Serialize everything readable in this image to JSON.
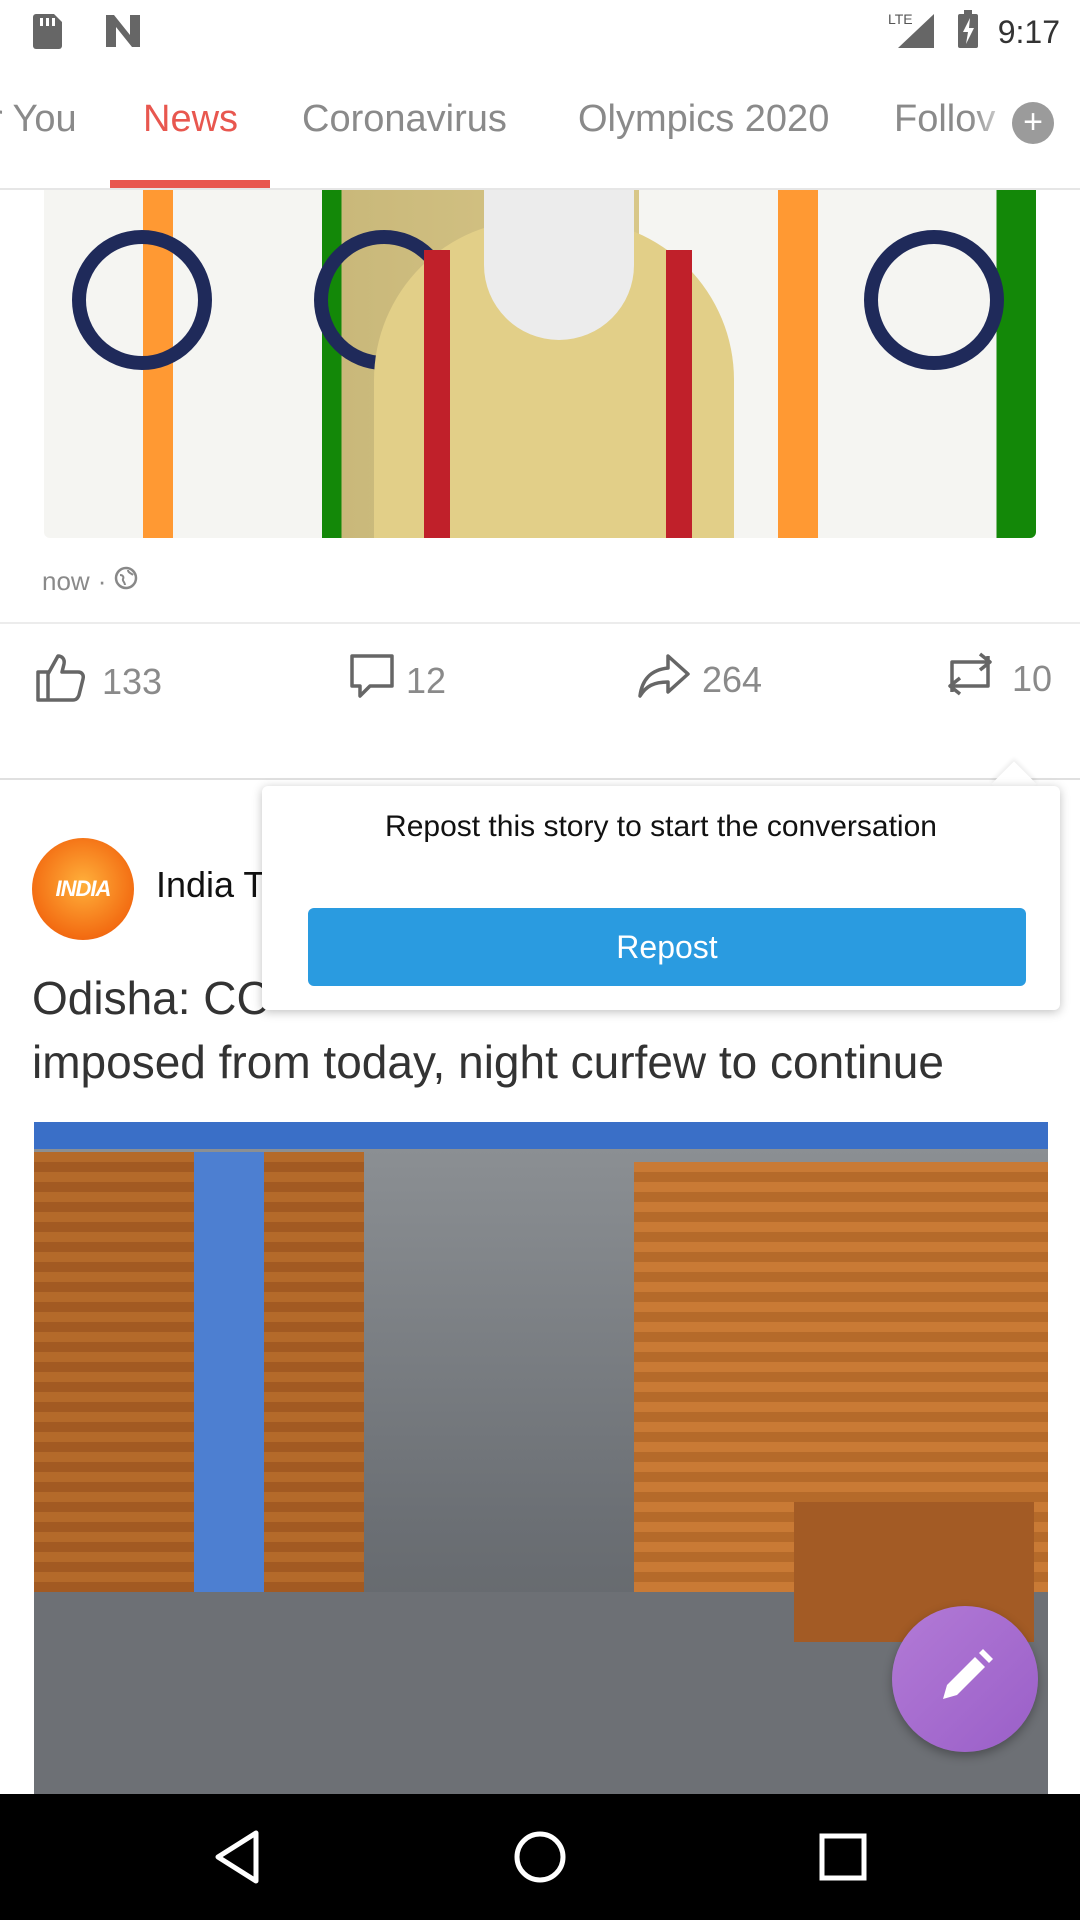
{
  "status_bar": {
    "time": "9:17",
    "network": "LTE",
    "icons": [
      "sd-card-icon",
      "n-logo-icon",
      "signal-icon",
      "battery-charging-icon"
    ]
  },
  "tabs": [
    {
      "label": "r You",
      "active": false
    },
    {
      "label": "News",
      "active": true
    },
    {
      "label": "Coronavirus",
      "active": false
    },
    {
      "label": "Olympics 2020",
      "active": false
    },
    {
      "label": "Follov",
      "active": false
    }
  ],
  "add_tab_label": "+",
  "post1": {
    "time": "now",
    "separator": "·",
    "actions": {
      "likes": "133",
      "comments": "12",
      "shares": "264",
      "reposts": "10"
    }
  },
  "popover": {
    "message": "Repost this story to start the conversation",
    "button_label": "Repost"
  },
  "post2": {
    "avatar_text": "INDIA",
    "source": "India T",
    "headline": "Odisha: CC                                                         imposed from today, night curfew to continue",
    "headline_line1": "Odisha: CC",
    "headline_line2": "imposed from today, night curfew to continue"
  },
  "colors": {
    "accent": "#e8574f",
    "repost_button": "#2a9be0",
    "fab": "#a56bcf"
  }
}
